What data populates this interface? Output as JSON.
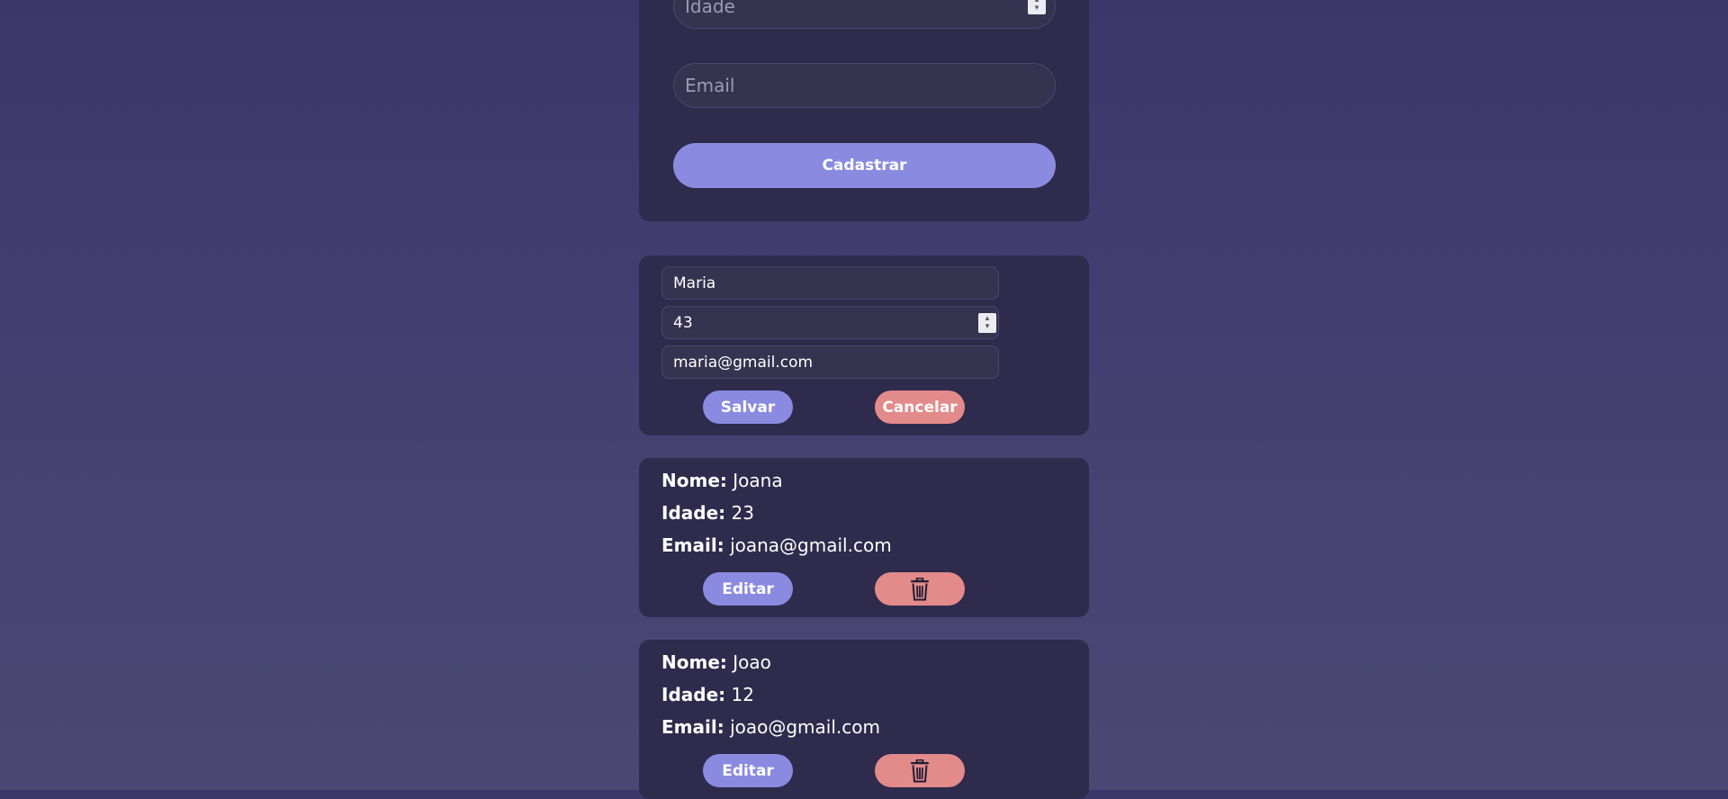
{
  "register_form": {
    "age_placeholder": "Idade",
    "email_placeholder": "Email",
    "submit_label": "Cadastrar"
  },
  "edit_form": {
    "name_value": "Maria",
    "age_value": "43",
    "email_value": "maria@gmail.com",
    "save_label": "Salvar",
    "cancel_label": "Cancelar"
  },
  "labels": {
    "name": "Nome:",
    "age": "Idade:",
    "email": "Email:"
  },
  "users": [
    {
      "name": "Joana",
      "age": "23",
      "email": "joana@gmail.com",
      "edit_label": "Editar",
      "delete_icon": "trash-icon"
    },
    {
      "name": "Joao",
      "age": "12",
      "email": "joao@gmail.com",
      "edit_label": "Editar",
      "delete_icon": "trash-icon"
    }
  ],
  "colors": {
    "accent": "#8a8be0",
    "danger": "#e38a8a",
    "card": "#2e2b4d",
    "input": "#35334f"
  }
}
